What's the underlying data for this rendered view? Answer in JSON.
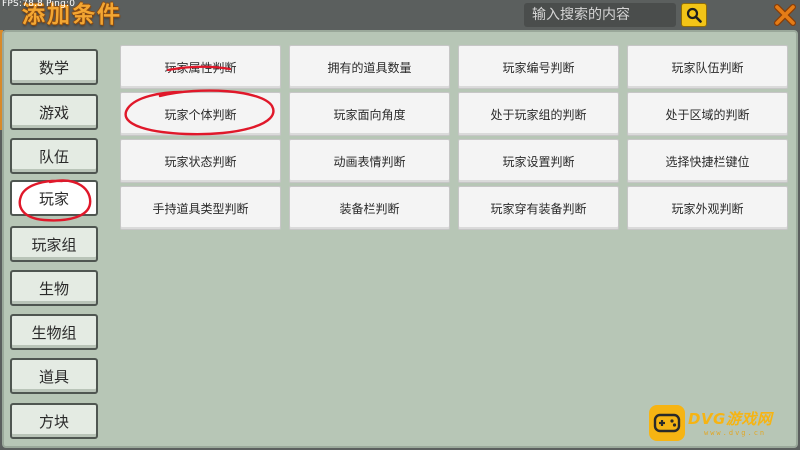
{
  "status_bar": {
    "fps_text": "FPS:78.8  Ping:0"
  },
  "header": {
    "title": "添加条件",
    "search_placeholder": "输入搜索的内容",
    "search_icon": "search-icon",
    "close_icon": "close-icon"
  },
  "sidebar": {
    "active": "玩家",
    "items": [
      {
        "label": "数学"
      },
      {
        "label": "游戏"
      },
      {
        "label": "队伍"
      },
      {
        "label": "玩家"
      },
      {
        "label": "玩家组"
      },
      {
        "label": "生物"
      },
      {
        "label": "生物组"
      },
      {
        "label": "道具"
      },
      {
        "label": "方块"
      }
    ]
  },
  "conditions": [
    {
      "label": "玩家属性判断"
    },
    {
      "label": "拥有的道具数量"
    },
    {
      "label": "玩家编号判断"
    },
    {
      "label": "玩家队伍判断"
    },
    {
      "label": "玩家个体判断"
    },
    {
      "label": "玩家面向角度"
    },
    {
      "label": "处于玩家组的判断"
    },
    {
      "label": "处于区域的判断"
    },
    {
      "label": "玩家状态判断"
    },
    {
      "label": "动画表情判断"
    },
    {
      "label": "玩家设置判断"
    },
    {
      "label": "选择快捷栏键位"
    },
    {
      "label": "手持道具类型判断"
    },
    {
      "label": "装备栏判断"
    },
    {
      "label": "玩家穿有装备判断"
    },
    {
      "label": "玩家外观判断"
    }
  ],
  "watermark": {
    "brand": "DVG游戏网",
    "sub": "www.dvg.cn",
    "icon": "gamepad-icon"
  },
  "colors": {
    "title_orange": "#f3a632",
    "search_button_yellow": "#f2c417",
    "close_orange": "#e57c16",
    "panel_green": "#b7c6b6",
    "annotation_red": "#e0182a"
  }
}
